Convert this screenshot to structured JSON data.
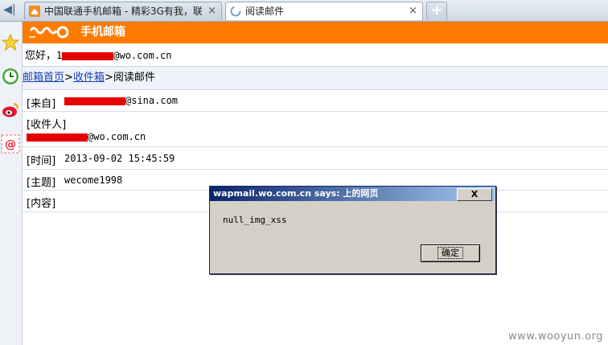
{
  "tabs": [
    {
      "title": "中国联通手机邮箱 - 精彩3G有我，联",
      "close": "×"
    },
    {
      "title": "阅读邮件",
      "close": "×"
    }
  ],
  "new_tab": "+",
  "back": "◀|",
  "brand": {
    "name": "手机邮箱",
    "color": "#ff7b00"
  },
  "greeting": {
    "prefix": "您好，",
    "visible_start": "1",
    "suffix": "@wo.com.cn"
  },
  "breadcrumb": {
    "home": "邮箱首页",
    "sep1": ">",
    "inbox": "收件箱",
    "sep2": ">",
    "current": "阅读邮件"
  },
  "email": {
    "from_label": "[来自]",
    "from_suffix": "@sina.com",
    "to_label": "[收件人]",
    "to_suffix": "@wo.com.cn",
    "time_label": "[时间]",
    "time_value": "2013-09-02 15:45:59",
    "subject_label": "[主题]",
    "subject_value": "wecome1998",
    "content_label": "[内容]"
  },
  "dialog": {
    "title": "wapmail.wo.com.cn says: 上的网页",
    "close_label": "X",
    "message": "null_img_xss",
    "ok_label": "确定"
  },
  "watermark": "www.wooyun.org",
  "sidebar_icons": [
    "star-icon",
    "clock-icon",
    "weibo-icon",
    "email-at-icon"
  ]
}
